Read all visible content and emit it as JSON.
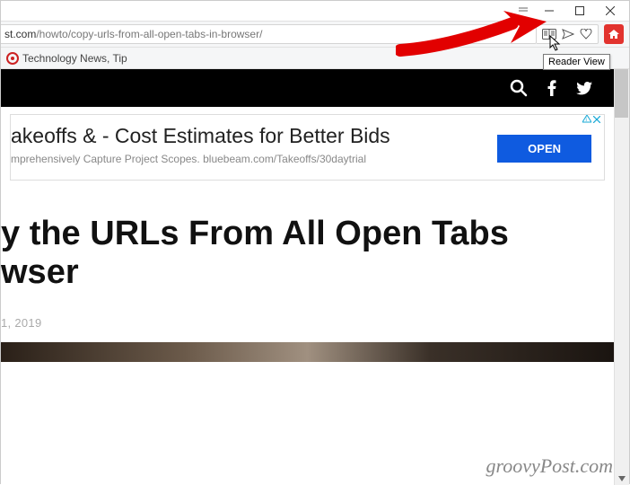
{
  "window": {
    "url_domain": "st.com",
    "url_path": "/howto/copy-urls-from-all-open-tabs-in-browser/",
    "tooltip": "Reader View"
  },
  "bookmarks": {
    "item1": "Technology News, Tip"
  },
  "ad": {
    "title": "akeoffs & - Cost Estimates for Better Bids",
    "subtitle": "mprehensively Capture Project Scopes. bluebeam.com/Takeoffs/30daytrial",
    "button": "OPEN"
  },
  "article": {
    "title_line1": "y the URLs From All Open Tabs",
    "title_line2": "wser",
    "date": "1, 2019"
  },
  "watermark": "groovyPost.com"
}
